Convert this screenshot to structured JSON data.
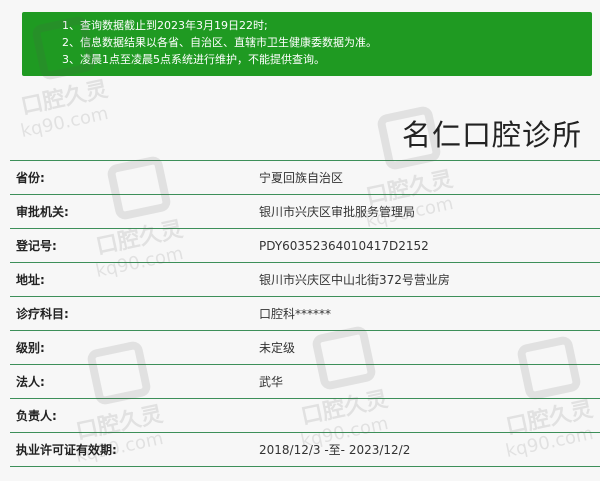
{
  "notice": {
    "lines": [
      "1、查询数据截止到2023年3月19日22时;",
      "2、信息数据结果以各省、自治区、直辖市卫生健康委数据为准。",
      "3、凌晨1点至凌晨5点系统进行维护，不能提供查询。"
    ]
  },
  "org": {
    "name": "名仁口腔诊所"
  },
  "details": [
    {
      "label": "省份:",
      "value": "宁夏回族自治区"
    },
    {
      "label": "审批机关:",
      "value": "银川市兴庆区审批服务管理局"
    },
    {
      "label": "登记号:",
      "value": "PDY60352364010417D2152"
    },
    {
      "label": "地址:",
      "value": "银川市兴庆区中山北街372号营业房"
    },
    {
      "label": "诊疗科目:",
      "value": "口腔科******"
    },
    {
      "label": "级别:",
      "value": "未定级"
    },
    {
      "label": "法人:",
      "value": "武华"
    },
    {
      "label": "负责人:",
      "value": ""
    },
    {
      "label": "执业许可证有效期:",
      "value": "2018/12/3 -至- 2023/12/2"
    }
  ],
  "watermark": {
    "text": "口腔久灵",
    "url": "kq90.com"
  }
}
